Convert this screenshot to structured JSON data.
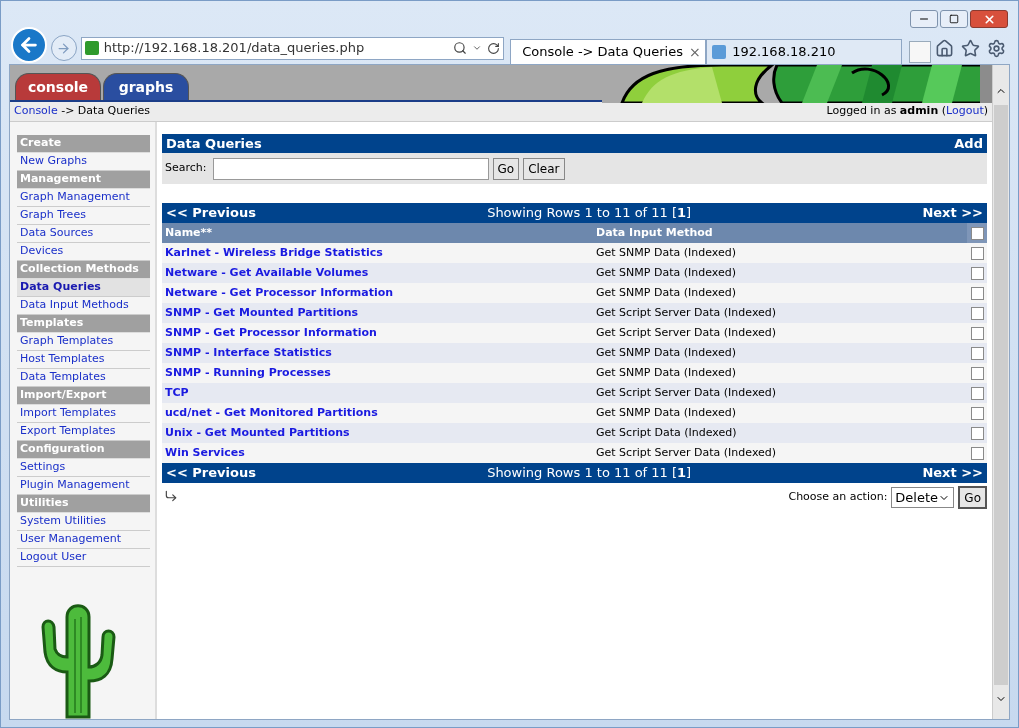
{
  "browser": {
    "address": "http://192.168.18.201/data_queries.php",
    "tabs": [
      {
        "title": "Console -> Data Queries",
        "selected": true,
        "close": "×"
      },
      {
        "title": "192.168.18.210",
        "selected": false
      }
    ]
  },
  "header_tabs": [
    {
      "label": "console",
      "color": "#b83a3a"
    },
    {
      "label": "graphs",
      "color": "#2a4ea0"
    }
  ],
  "breadcrumb": {
    "link": "Console",
    "rest": "-> Data Queries"
  },
  "login": {
    "before": "Logged in as **admin** (",
    "link": "Logout",
    "after": ")"
  },
  "sidebar": [
    {
      "title": "Create",
      "items": [
        {
          "label": "New Graphs",
          "selected": false
        }
      ]
    },
    {
      "title": "Management",
      "items": [
        {
          "label": "Graph Management",
          "selected": false
        },
        {
          "label": "Graph Trees",
          "selected": false
        },
        {
          "label": "Data Sources",
          "selected": false
        },
        {
          "label": "Devices",
          "selected": false
        }
      ]
    },
    {
      "title": "Collection Methods",
      "items": [
        {
          "label": "Data Queries",
          "selected": true
        },
        {
          "label": "Data Input Methods",
          "selected": false
        }
      ]
    },
    {
      "title": "Templates",
      "items": [
        {
          "label": "Graph Templates",
          "selected": false
        },
        {
          "label": "Host Templates",
          "selected": false
        },
        {
          "label": "Data Templates",
          "selected": false
        }
      ]
    },
    {
      "title": "Import/Export",
      "items": [
        {
          "label": "Import Templates",
          "selected": false
        },
        {
          "label": "Export Templates",
          "selected": false
        }
      ]
    },
    {
      "title": "Configuration",
      "items": [
        {
          "label": "Settings",
          "selected": false
        },
        {
          "label": "Plugin Management",
          "selected": false
        }
      ]
    },
    {
      "title": "Utilities",
      "items": [
        {
          "label": "System Utilities",
          "selected": false
        },
        {
          "label": "User Management",
          "selected": false
        },
        {
          "label": "Logout User",
          "selected": false
        }
      ]
    }
  ],
  "panel": {
    "title": "Data Queries",
    "add": "Add",
    "search_label": "Search:",
    "go": "Go",
    "clear": "Clear"
  },
  "pager": [
    {
      "previous": "<< Previous",
      "showing": "Showing Rows 1 to 11 of 11 [**1**]",
      "next": "Next >>"
    },
    {
      "previous": "<< Previous",
      "showing": "Showing Rows 1 to 11 of 11 [**1**]",
      "next": "Next >>"
    }
  ],
  "table": {
    "columns": [
      "Name**",
      "Data Input Method"
    ],
    "select_all_checked": false,
    "rows": [
      {
        "name": "Karlnet - Wireless Bridge Statistics",
        "method": "Get SNMP Data (Indexed)",
        "checked": false
      },
      {
        "name": "Netware - Get Available Volumes",
        "method": "Get SNMP Data (Indexed)",
        "checked": false
      },
      {
        "name": "Netware - Get Processor Information",
        "method": "Get SNMP Data (Indexed)",
        "checked": false
      },
      {
        "name": "SNMP - Get Mounted Partitions",
        "method": "Get Script Server Data (Indexed)",
        "checked": false
      },
      {
        "name": "SNMP - Get Processor Information",
        "method": "Get Script Server Data (Indexed)",
        "checked": false
      },
      {
        "name": "SNMP - Interface Statistics",
        "method": "Get SNMP Data (Indexed)",
        "checked": false
      },
      {
        "name": "SNMP - Running Processes",
        "method": "Get SNMP Data (Indexed)",
        "checked": false
      },
      {
        "name": "TCP",
        "method": "Get Script Server Data (Indexed)",
        "checked": false
      },
      {
        "name": "ucd/net - Get Monitored Partitions",
        "method": "Get SNMP Data (Indexed)",
        "checked": false
      },
      {
        "name": "Unix - Get Mounted Partitions",
        "method": "Get Script Data (Indexed)",
        "checked": false
      },
      {
        "name": "Win Services",
        "method": "Get Script Server Data (Indexed)",
        "checked": false
      }
    ]
  },
  "action": {
    "label": "Choose an action:",
    "value": "Delete",
    "go": "Go"
  }
}
